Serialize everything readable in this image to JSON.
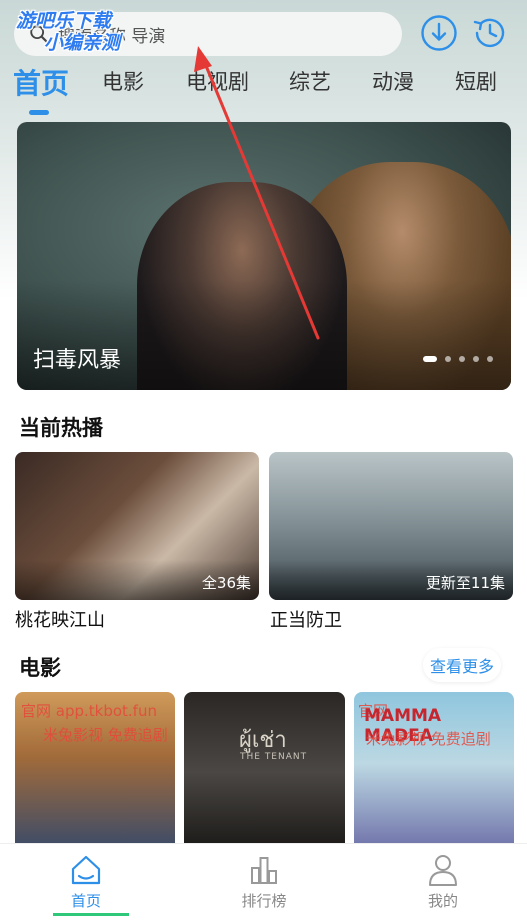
{
  "search": {
    "placeholder": "搜索名称 导演"
  },
  "watermark": {
    "line1": "游吧乐下载",
    "line2": "小编亲测"
  },
  "tabs": [
    {
      "label": "首页",
      "active": true
    },
    {
      "label": "电影"
    },
    {
      "label": "电视剧"
    },
    {
      "label": "综艺"
    },
    {
      "label": "动漫"
    },
    {
      "label": "短剧"
    }
  ],
  "banner": {
    "title": "扫毒风暴",
    "slides": 5,
    "active_slide": 1
  },
  "hot": {
    "title": "当前热播",
    "items": [
      {
        "name": "桃花映江山",
        "badge": "全36集"
      },
      {
        "name": "正当防卫",
        "badge": "更新至11集"
      }
    ]
  },
  "movies": {
    "title": "电影",
    "more_label": "查看更多",
    "posters": [
      {
        "line1": "官网 app.tkbot.fun",
        "line2": "米兔影视 免费追剧"
      },
      {
        "logo": "ผู้เช่า",
        "sub": "THE TENANT"
      },
      {
        "title": "MAMMA MADEA",
        "line1": "官网",
        "line2": "米兔影视 免费追剧"
      }
    ]
  },
  "bottom_nav": [
    {
      "label": "首页",
      "icon": "home-icon",
      "active": true
    },
    {
      "label": "排行榜",
      "icon": "ranking-icon"
    },
    {
      "label": "我的",
      "icon": "user-icon"
    }
  ],
  "colors": {
    "accent": "#2d8fe8",
    "annotation_arrow": "#e53935",
    "nav_indicator": "#2fc77a"
  }
}
